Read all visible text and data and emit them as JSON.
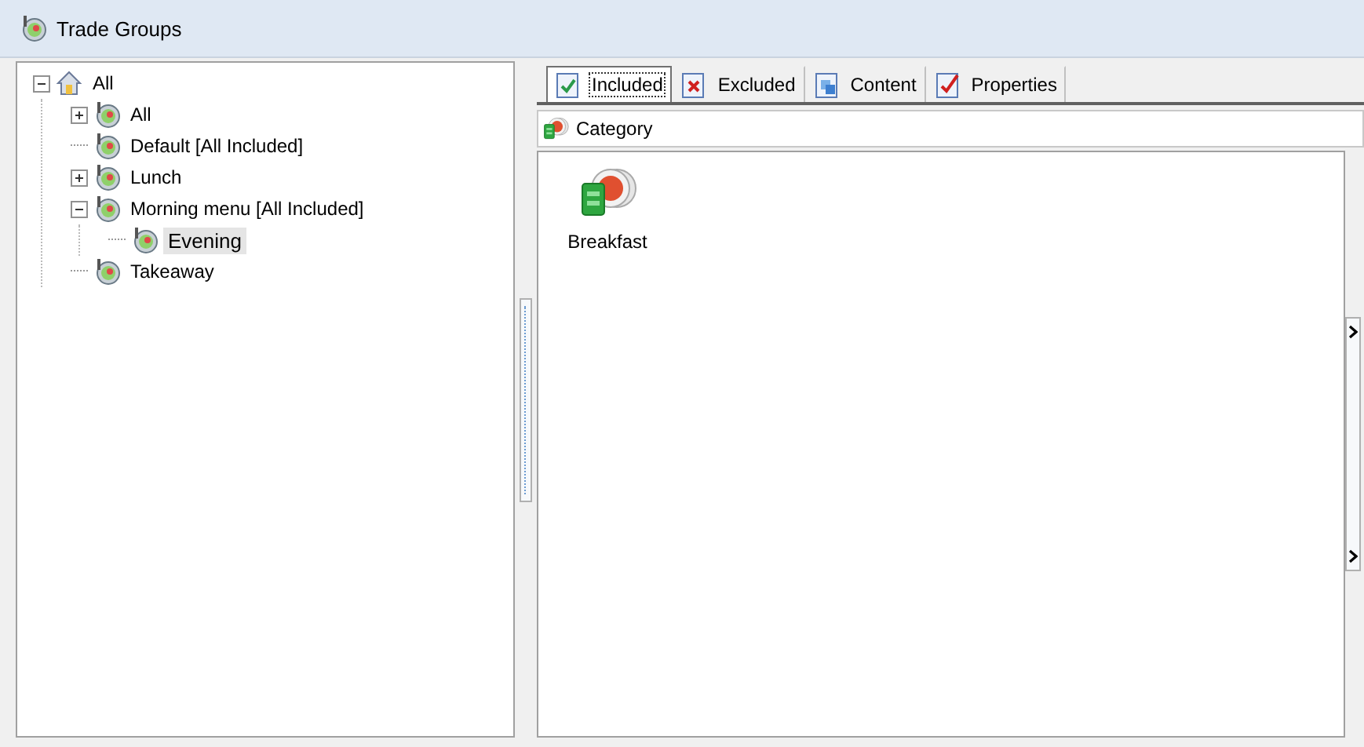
{
  "window": {
    "title": "Trade Groups"
  },
  "tree": [
    {
      "label": "All",
      "kind": "root",
      "expanded": true,
      "selected": false,
      "children": [
        {
          "label": "All",
          "expanded": false,
          "selected": false,
          "has_children": true
        },
        {
          "label": "Default [All Included]",
          "selected": false,
          "has_children": false
        },
        {
          "label": "Lunch",
          "expanded": false,
          "selected": false,
          "has_children": true
        },
        {
          "label": "Morning menu [All Included]",
          "expanded": true,
          "selected": false,
          "has_children": true,
          "children": [
            {
              "label": "Evening",
              "selected": true,
              "has_children": false
            }
          ]
        },
        {
          "label": "Takeaway",
          "selected": false,
          "has_children": false
        }
      ]
    }
  ],
  "tabs": [
    {
      "label": "Included",
      "kind": "included",
      "selected": true
    },
    {
      "label": "Excluded",
      "kind": "excluded",
      "selected": false
    },
    {
      "label": "Content",
      "kind": "content",
      "selected": false
    },
    {
      "label": "Properties",
      "kind": "properties",
      "selected": false
    }
  ],
  "header": {
    "label": "Category"
  },
  "items": [
    {
      "label": "Breakfast"
    }
  ]
}
